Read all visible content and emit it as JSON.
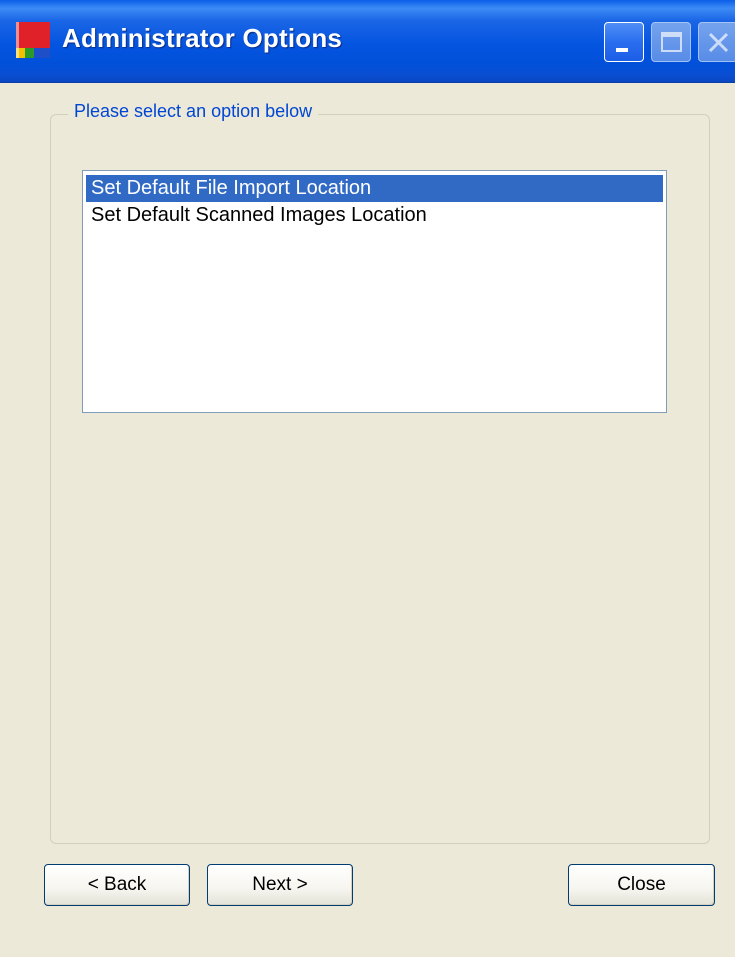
{
  "window": {
    "title": "Administrator Options",
    "icon": "app-logo-icon"
  },
  "titlebar_buttons": {
    "minimize": "minimize-icon",
    "maximize": "maximize-icon",
    "close": "close-icon"
  },
  "group": {
    "legend": "Please select an option below"
  },
  "options": {
    "items": [
      {
        "label": "Set Default File Import Location",
        "selected": true
      },
      {
        "label": "Set Default Scanned Images Location",
        "selected": false
      }
    ]
  },
  "buttons": {
    "back": "< Back",
    "next": "Next >",
    "close": "Close"
  },
  "colors": {
    "titlebar": "#0454e0",
    "selection": "#316ac5",
    "legend_text": "#0046d5",
    "window_bg": "#ece9d8"
  }
}
